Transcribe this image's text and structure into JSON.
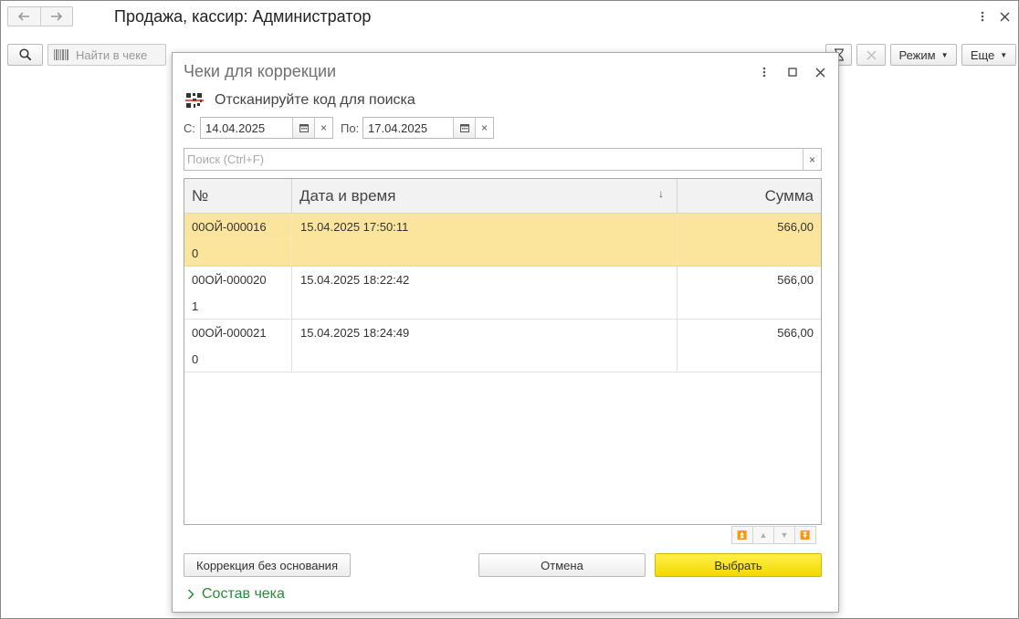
{
  "window": {
    "title": "Продажа, кассир: Администратор"
  },
  "toolbar": {
    "find_placeholder": "Найти в чеке",
    "mode_label": "Режим",
    "more_label": "Еще"
  },
  "dialog": {
    "title": "Чеки для коррекции",
    "scan_prompt": "Отсканируйте код для поиска",
    "from_label": "С:",
    "from_date": "14.04.2025",
    "to_label": "По:",
    "to_date": "17.04.2025",
    "search_placeholder": "Поиск (Ctrl+F)",
    "columns": {
      "num": "№",
      "datetime": "Дата и время",
      "sum": "Сумма"
    },
    "rows": [
      {
        "num": "00ОЙ-000016",
        "sub": "0",
        "datetime": "15.04.2025 17:50:11",
        "sum": "566,00",
        "selected": true
      },
      {
        "num": "00ОЙ-000020",
        "sub": "1",
        "datetime": "15.04.2025 18:22:42",
        "sum": "566,00",
        "selected": false
      },
      {
        "num": "00ОЙ-000021",
        "sub": "0",
        "datetime": "15.04.2025 18:24:49",
        "sum": "566,00",
        "selected": false
      }
    ],
    "buttons": {
      "correction": "Коррекция без основания",
      "cancel": "Отмена",
      "choose": "Выбрать"
    },
    "composition_link": "Состав чека"
  },
  "colors": {
    "selected_row": "#fbe59c",
    "primary_button": "#f5dc00",
    "link": "#2a8a3a"
  }
}
